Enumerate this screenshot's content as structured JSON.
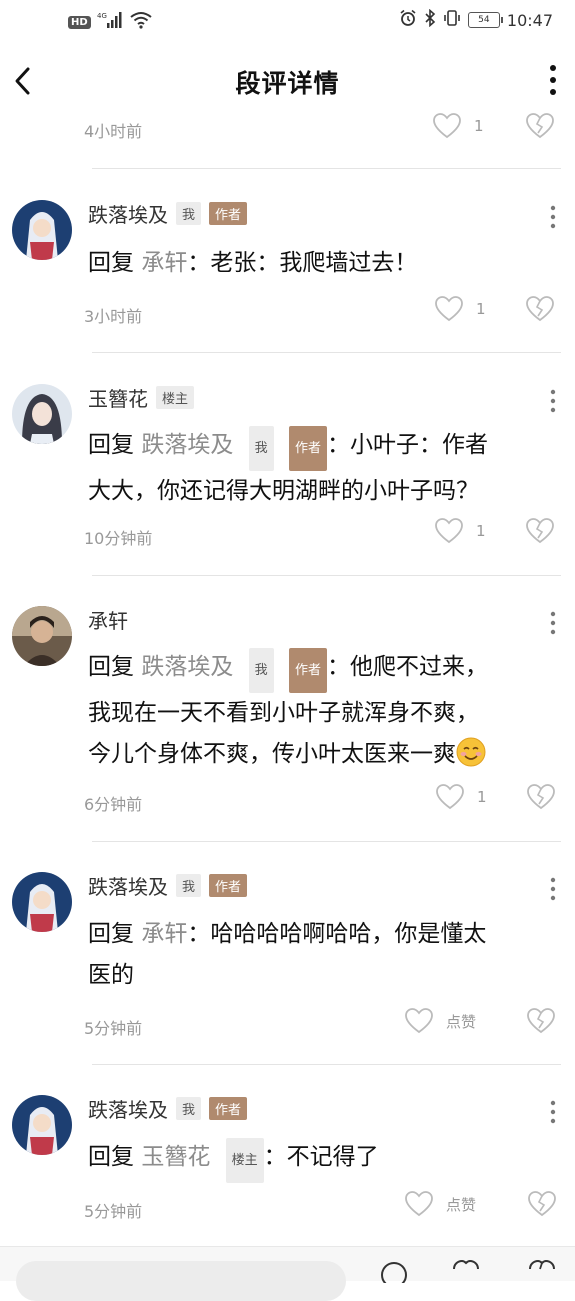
{
  "status": {
    "network": "HD",
    "signal": "4G",
    "battery": "54",
    "time": "10:47"
  },
  "nav": {
    "title": "段评详情"
  },
  "top_partial": {
    "time": "4小时前",
    "like_count": "1"
  },
  "comments": [
    {
      "user": "跌落埃及",
      "tags": [
        "我",
        "作者"
      ],
      "reply_label": "回复",
      "reply_target": "承轩",
      "text": "：老张：我爬墙过去！",
      "time": "3小时前",
      "likes": "1"
    },
    {
      "user": "玉簪花",
      "tags": [
        "楼主"
      ],
      "reply_label": "回复",
      "reply_target": "跌落埃及",
      "reply_tags": [
        "我",
        "作者"
      ],
      "text_line1": "：小叶子：作者",
      "text_line2": "大大，你还记得大明湖畔的小叶子吗？",
      "time": "10分钟前",
      "likes": "1"
    },
    {
      "user": "承轩",
      "tags": [],
      "reply_label": "回复",
      "reply_target": "跌落埃及",
      "reply_tags": [
        "我",
        "作者"
      ],
      "text_line1": "：他爬不过来，",
      "text_line2": "我现在一天不看到小叶子就浑身不爽，",
      "text_line3": "今儿个身体不爽，传小叶太医来一爽",
      "emoji": "smiling-face-icon",
      "time": "6分钟前",
      "likes": "1"
    },
    {
      "user": "跌落埃及",
      "tags": [
        "我",
        "作者"
      ],
      "reply_label": "回复",
      "reply_target": "承轩",
      "text_line1": "：哈哈哈哈啊哈哈，你是懂太",
      "text_line2": "医的",
      "time": "5分钟前",
      "likes": "点赞"
    },
    {
      "user": "跌落埃及",
      "tags": [
        "我",
        "作者"
      ],
      "reply_label": "回复",
      "reply_target": "玉簪花",
      "reply_tags": [
        "楼主"
      ],
      "text": "：不记得了",
      "time": "5分钟前",
      "likes": "点赞"
    }
  ],
  "colors": {
    "author_tag": "#b08a6e",
    "muted_text": "#999999",
    "reply_target": "#8c8c8c"
  }
}
